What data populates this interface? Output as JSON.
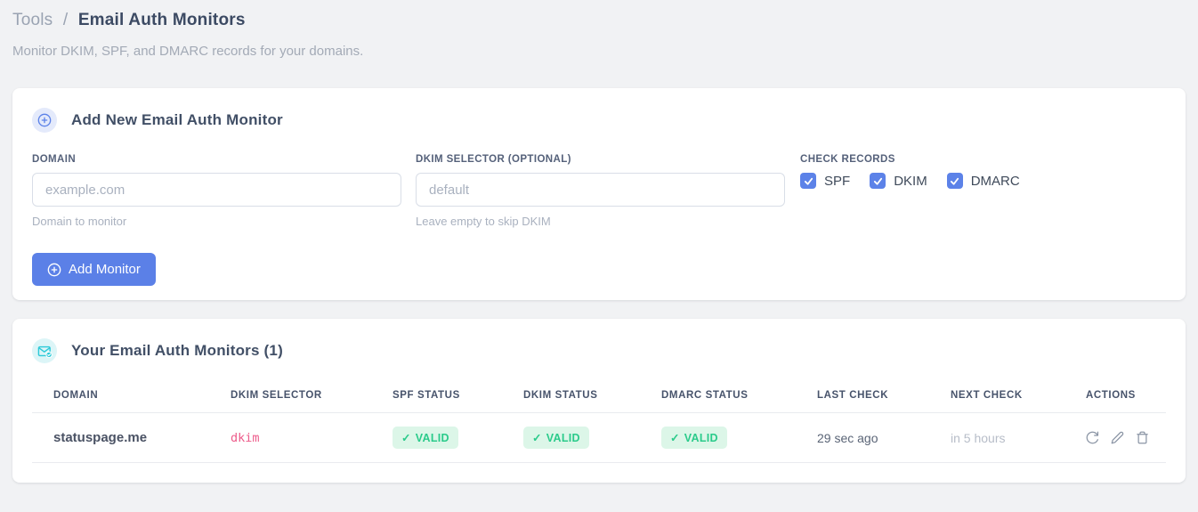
{
  "page": {
    "breadcrumb": {
      "root": "Tools",
      "separator": "/",
      "current": "Email Auth Monitors"
    },
    "subtitle": "Monitor DKIM, SPF, and DMARC records for your domains."
  },
  "add_monitor_card": {
    "title": "Add New Email Auth Monitor",
    "icon": "plus-circle-icon",
    "fields": {
      "domain": {
        "label": "DOMAIN",
        "value": "",
        "placeholder": "example.com",
        "hint": "Domain to monitor"
      },
      "dkim_selector": {
        "label": "DKIM SELECTOR (OPTIONAL)",
        "value": "",
        "placeholder": "default",
        "hint": "Leave empty to skip DKIM"
      }
    },
    "check_records": {
      "label": "CHECK RECORDS",
      "options": [
        {
          "label": "SPF",
          "checked": true
        },
        {
          "label": "DKIM",
          "checked": true
        },
        {
          "label": "DMARC",
          "checked": true
        }
      ]
    },
    "submit_label": "Add Monitor"
  },
  "monitors_card": {
    "title": "Your Email Auth Monitors (1)",
    "icon": "email-check-icon",
    "table": {
      "headers": [
        "DOMAIN",
        "DKIM SELECTOR",
        "SPF STATUS",
        "DKIM STATUS",
        "DMARC STATUS",
        "LAST CHECK",
        "NEXT CHECK",
        "ACTIONS"
      ],
      "rows": [
        {
          "domain": "statuspage.me",
          "dkim_selector": "dkim",
          "check_glyph": "✓",
          "spf_status": "VALID",
          "dkim_status": "VALID",
          "dmarc_status": "VALID",
          "last_check": "29 sec ago",
          "next_check": "in 5 hours",
          "actions": [
            "refresh-icon",
            "edit-icon",
            "delete-icon"
          ]
        }
      ]
    }
  },
  "colors": {
    "accent_blue": "#5b80e7",
    "icon_cyan": "#2bc9d8",
    "badge_green_text": "#2bcb8b",
    "badge_green_bg": "#dcf6e8",
    "selector_pink": "#ed5b8a"
  }
}
